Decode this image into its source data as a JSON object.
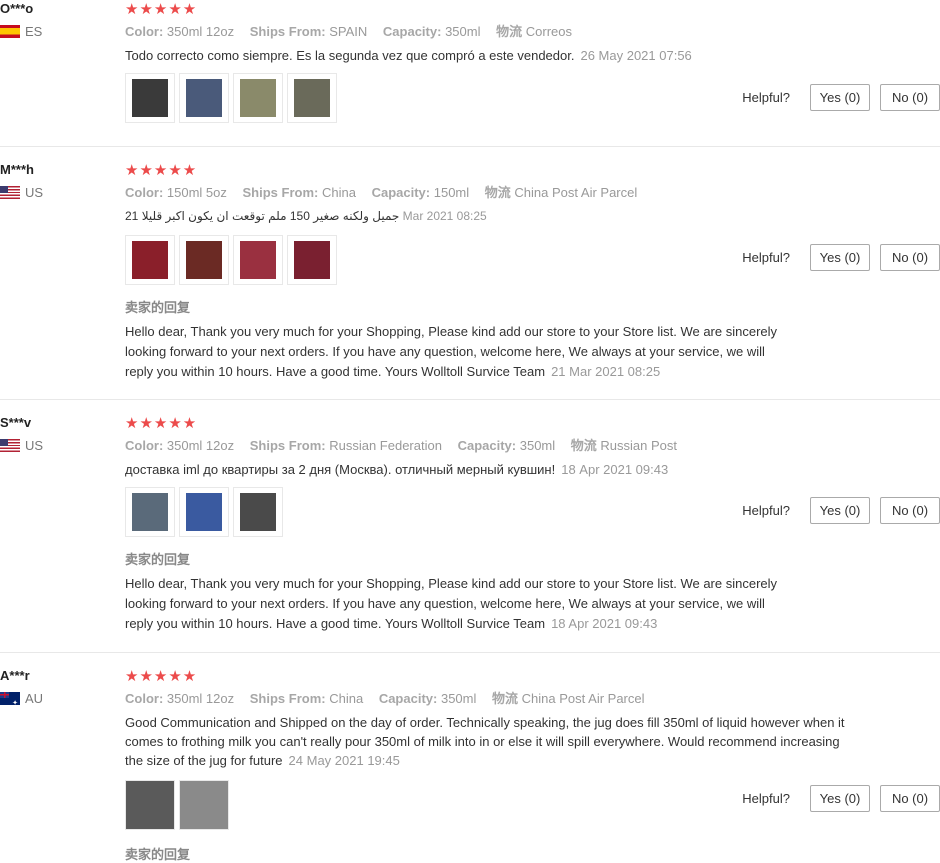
{
  "labels": {
    "color": "Color:",
    "ships_from": "Ships From:",
    "capacity": "Capacity:",
    "logistics": "物流",
    "helpful": "Helpful?",
    "seller_reply_title": "卖家的回复",
    "stars": "★★★★★"
  },
  "reviews": [
    {
      "user": "O***o",
      "country": "ES",
      "flag": "spain-flag-icon",
      "color": "350ml 12oz",
      "ships_from": "SPAIN",
      "capacity": "350ml",
      "logistics": "Correos",
      "text": "Todo correcto como siempre. Es la segunda vez que compró a este vendedor.",
      "date": "26 May 2021 07:56",
      "yes": "Yes (0)",
      "no": "No (0)",
      "thumb_colors": [
        "#3a3a3a",
        "#4a5a7a",
        "#8a8a6a",
        "#6a6a5a"
      ]
    },
    {
      "user": "M***h",
      "country": "US",
      "flag": "us-flag-icon",
      "color": "150ml 5oz",
      "ships_from": "China",
      "capacity": "150ml",
      "logistics": "China Post Air Parcel",
      "text_rtl": "جميل ولكنه صغير 150 ملم توقعت ان يكون اكبر قليلا",
      "text_num": "21",
      "date": "Mar 2021 08:25",
      "yes": "Yes (0)",
      "no": "No (0)",
      "thumb_colors": [
        "#8a1f2a",
        "#6b2a24",
        "#9a3040",
        "#7a2030"
      ],
      "reply": "Hello dear, Thank you very much for your Shopping, Please kind add our store to your Store list. We are sincerely looking forward to your next orders. If you have any question, welcome here, We always at your service, we will reply you within 10 hours. Have a good time. Yours Wolltoll Survice Team",
      "reply_date": "21 Mar 2021 08:25"
    },
    {
      "user": "S***v",
      "country": "US",
      "flag": "us-flag-icon",
      "color": "350ml 12oz",
      "ships_from": "Russian Federation",
      "capacity": "350ml",
      "logistics": "Russian Post",
      "text": "доставка iml до квартиры за 2 дня (Москва). отличный мерный кувшин!",
      "date": "18 Apr 2021 09:43",
      "yes": "Yes (0)",
      "no": "No (0)",
      "thumb_colors": [
        "#5a6a7a",
        "#3a5aa0",
        "#4a4a4a"
      ],
      "reply": "Hello dear, Thank you very much for your Shopping, Please kind add our store to your Store list. We are sincerely looking forward to your next orders. If you have any question, welcome here, We always at your service, we will reply you within 10 hours. Have a good time. Yours Wolltoll Survice Team",
      "reply_date": "18 Apr 2021 09:43"
    },
    {
      "user": "A***r",
      "country": "AU",
      "flag": "australia-flag-icon",
      "color": "350ml 12oz",
      "ships_from": "China",
      "capacity": "350ml",
      "logistics": "China Post Air Parcel",
      "text": "Good Communication and Shipped on the day of order. Technically speaking, the jug does fill 350ml of liquid however when it comes to frothing milk you can't really pour 350ml of milk into in or else it will spill everywhere. Would recommend increasing the size of the jug for future",
      "date": "24 May 2021 19:45",
      "yes": "Yes (0)",
      "no": "No (0)",
      "thumb_colors": [
        "#5a5a5a",
        "#8a8a8a"
      ]
    }
  ]
}
